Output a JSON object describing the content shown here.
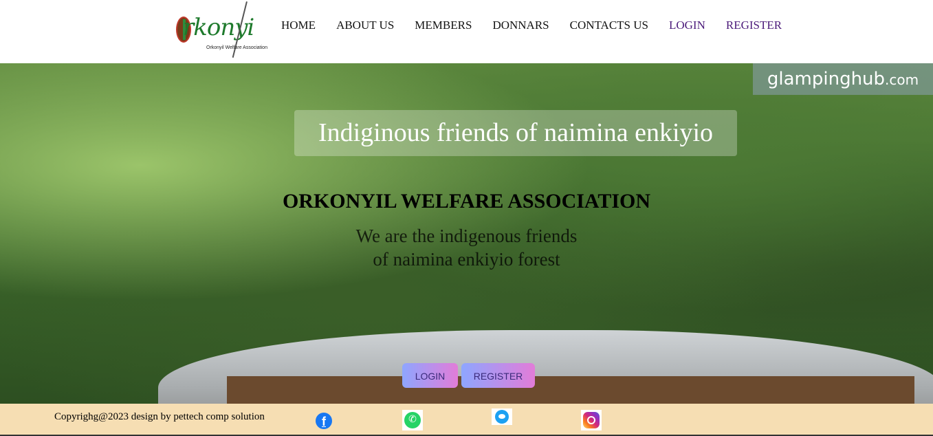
{
  "header": {
    "logo_text": "rkonyi",
    "logo_sub": "Orkonyil Welfare Association",
    "nav": [
      {
        "label": "HOME"
      },
      {
        "label": "ABOUT US"
      },
      {
        "label": "MEMBERS"
      },
      {
        "label": "DONNARS"
      },
      {
        "label": "CONTACTS US"
      },
      {
        "label": "LOGIN"
      },
      {
        "label": "REGISTER"
      }
    ]
  },
  "hero": {
    "watermark": "glampinghub",
    "watermark_tld": ".com",
    "tagline": "Indiginous friends of naimina enkiyio",
    "org_name": "ORKONYIL WELFARE ASSOCIATION",
    "subtitle_line1": "We are the indigenous friends",
    "subtitle_line2": "of naimina enkiyio forest",
    "login_button": "LOGIN",
    "register_button": "REGISTER"
  },
  "footer": {
    "copyright": "Copyrighg@2023 design by pettech comp solution",
    "social": [
      {
        "icon": "facebook-icon",
        "color": "#1877f2"
      },
      {
        "icon": "whatsapp-icon",
        "color": "#25d366"
      },
      {
        "icon": "twitter-icon",
        "color": "#1da1f2"
      },
      {
        "icon": "instagram-icon",
        "color": "#d62976"
      }
    ]
  },
  "colors": {
    "footer_bg": "#f6deb3",
    "visited_link": "#4b1a7a",
    "button_gradient": [
      "#8ea6ff",
      "#e27cd8"
    ]
  }
}
